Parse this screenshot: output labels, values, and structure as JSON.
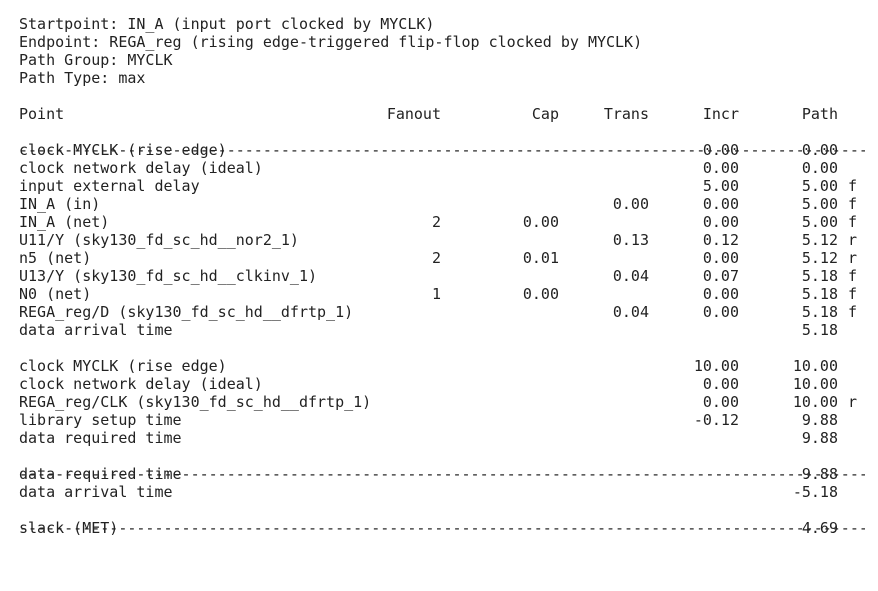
{
  "header": {
    "startpoint": "Startpoint: IN_A (input port clocked by MYCLK)",
    "endpoint": "Endpoint: REGA_reg (rising edge-triggered flip-flop clocked by MYCLK)",
    "path_group": "Path Group: MYCLK",
    "path_type": "Path Type: max"
  },
  "columns": {
    "point": "Point",
    "fanout": "Fanout",
    "cap": "Cap",
    "trans": "Trans",
    "incr": "Incr",
    "path": "Path"
  },
  "separator": "-------------------------------------------------------------------------------------------------------",
  "arrival_rows": [
    {
      "point": "clock MYCLK (rise edge)",
      "fanout": "",
      "cap": "",
      "trans": "",
      "incr": "0.00",
      "path": "0.00",
      "edge": ""
    },
    {
      "point": "clock network delay (ideal)",
      "fanout": "",
      "cap": "",
      "trans": "",
      "incr": "0.00",
      "path": "0.00",
      "edge": ""
    },
    {
      "point": "input external delay",
      "fanout": "",
      "cap": "",
      "trans": "",
      "incr": "5.00",
      "path": "5.00",
      "edge": "f"
    },
    {
      "point": "IN_A (in)",
      "fanout": "",
      "cap": "",
      "trans": "0.00",
      "incr": "0.00",
      "path": "5.00",
      "edge": "f"
    },
    {
      "point": "IN_A (net)",
      "fanout": "2",
      "cap": "0.00",
      "trans": "",
      "incr": "0.00",
      "path": "5.00",
      "edge": "f"
    },
    {
      "point": "U11/Y (sky130_fd_sc_hd__nor2_1)",
      "fanout": "",
      "cap": "",
      "trans": "0.13",
      "incr": "0.12",
      "path": "5.12",
      "edge": "r"
    },
    {
      "point": "n5 (net)",
      "fanout": "2",
      "cap": "0.01",
      "trans": "",
      "incr": "0.00",
      "path": "5.12",
      "edge": "r"
    },
    {
      "point": "U13/Y (sky130_fd_sc_hd__clkinv_1)",
      "fanout": "",
      "cap": "",
      "trans": "0.04",
      "incr": "0.07",
      "path": "5.18",
      "edge": "f"
    },
    {
      "point": "N0 (net)",
      "fanout": "1",
      "cap": "0.00",
      "trans": "",
      "incr": "0.00",
      "path": "5.18",
      "edge": "f"
    },
    {
      "point": "REGA_reg/D (sky130_fd_sc_hd__dfrtp_1)",
      "fanout": "",
      "cap": "",
      "trans": "0.04",
      "incr": "0.00",
      "path": "5.18",
      "edge": "f"
    },
    {
      "point": "data arrival time",
      "fanout": "",
      "cap": "",
      "trans": "",
      "incr": "",
      "path": "5.18",
      "edge": ""
    }
  ],
  "required_rows": [
    {
      "point": "clock MYCLK (rise edge)",
      "fanout": "",
      "cap": "",
      "trans": "",
      "incr": "10.00",
      "path": "10.00",
      "edge": ""
    },
    {
      "point": "clock network delay (ideal)",
      "fanout": "",
      "cap": "",
      "trans": "",
      "incr": "0.00",
      "path": "10.00",
      "edge": ""
    },
    {
      "point": "REGA_reg/CLK (sky130_fd_sc_hd__dfrtp_1)",
      "fanout": "",
      "cap": "",
      "trans": "",
      "incr": "0.00",
      "path": "10.00",
      "edge": "r"
    },
    {
      "point": "library setup time",
      "fanout": "",
      "cap": "",
      "trans": "",
      "incr": "-0.12",
      "path": "9.88",
      "edge": ""
    },
    {
      "point": "data required time",
      "fanout": "",
      "cap": "",
      "trans": "",
      "incr": "",
      "path": "9.88",
      "edge": ""
    }
  ],
  "summary_rows": [
    {
      "point": "data required time",
      "path": "9.88"
    },
    {
      "point": "data arrival time",
      "path": "-5.18"
    }
  ],
  "slack": {
    "point": "slack (MET)",
    "path": "4.69"
  }
}
